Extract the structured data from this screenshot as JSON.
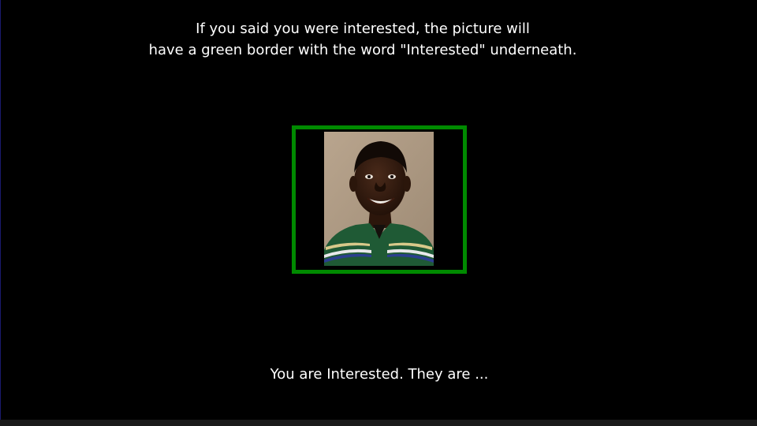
{
  "instructions": {
    "line1": "If you said you were interested, the picture will",
    "line2": "have a green border with the word \"Interested\" underneath."
  },
  "photo": {
    "subject": "portrait of a smiling young man in a striped shirt",
    "icon": "person-photo-icon"
  },
  "frame": {
    "border_color": "#008a00",
    "state": "Interested"
  },
  "status": {
    "text": "You are Interested. They are ..."
  },
  "colors": {
    "background": "#000000",
    "text": "#ffffff",
    "accent_green": "#008a00"
  }
}
